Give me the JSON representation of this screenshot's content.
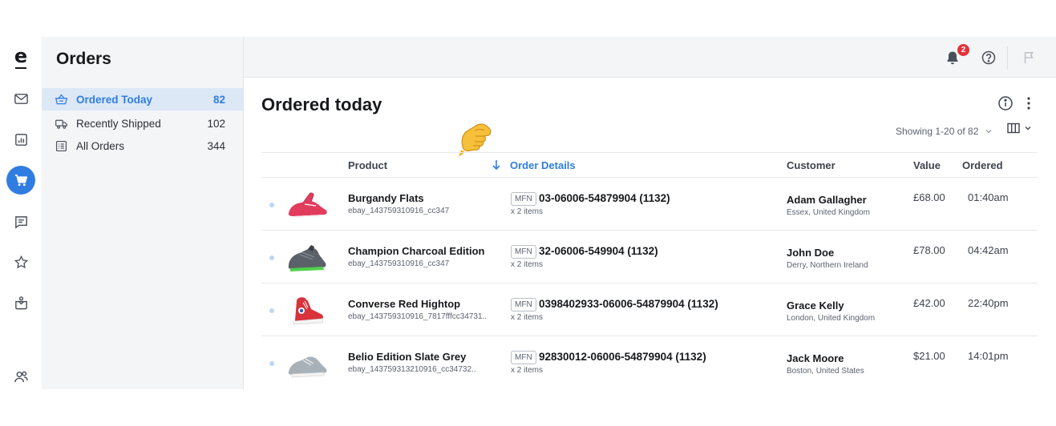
{
  "app": {
    "logo_letter": "e"
  },
  "rail": {
    "items": [
      {
        "icon": "mail-icon"
      },
      {
        "icon": "reports-icon"
      },
      {
        "icon": "cart-icon",
        "active": true
      },
      {
        "icon": "messages-icon"
      },
      {
        "icon": "star-icon"
      },
      {
        "icon": "box-icon"
      },
      {
        "icon": "users-icon"
      }
    ]
  },
  "sidebar": {
    "title": "Orders",
    "items": [
      {
        "label": "Ordered Today",
        "count": "82",
        "icon": "basket-icon",
        "active": true
      },
      {
        "label": "Recently Shipped",
        "count": "102",
        "icon": "truck-icon"
      },
      {
        "label": "All Orders",
        "count": "344",
        "icon": "list-icon"
      }
    ]
  },
  "topbar": {
    "notification_count": "2",
    "icons": [
      "bell-icon",
      "help-icon",
      "flag-icon"
    ]
  },
  "main": {
    "title": "Ordered today",
    "showing": "Showing 1-20 of 82",
    "columns": {
      "product": "Product",
      "order_details": "Order Details",
      "customer": "Customer",
      "value": "Value",
      "ordered": "Ordered"
    },
    "rows": [
      {
        "product": "Burgandy Flats",
        "sku": "ebay_143759310916_cc347",
        "tag": "MFN",
        "order_id": "03-06006-54879904 (1132)",
        "items": "x 2 items",
        "customer": "Adam Gallagher",
        "location": "Essex, United Kingdom",
        "value": "£68.00",
        "time": "01:40am",
        "shoe_color": "#e23c5d"
      },
      {
        "product": "Champion Charcoal Edition",
        "sku": "ebay_143759310916_cc347",
        "tag": "MFN",
        "order_id": "32-06006-549904 (1132)",
        "items": "x 2 items",
        "customer": "John Doe",
        "location": "Derry, Northern Ireland",
        "value": "£78.00",
        "time": "04:42am",
        "shoe_color": "#5b6168"
      },
      {
        "product": "Converse Red Hightop",
        "sku": "ebay_143759310916_7817fffcc34731..",
        "tag": "MFN",
        "order_id": "0398402933-06006-54879904 (1132)",
        "items": "x 2 items",
        "customer": "Grace Kelly",
        "location": "London, United Kingdom",
        "value": "£42.00",
        "time": "22:40pm",
        "shoe_color": "#d8323a"
      },
      {
        "product": "Belio Edition Slate Grey",
        "sku": "ebay_143759313210916_cc34732..",
        "tag": "MFN",
        "order_id": "92830012-06006-54879904 (1132)",
        "items": "x 2 items",
        "customer": "Jack Moore",
        "location": "Boston, United States",
        "value": "$21.00",
        "time": "14:01pm",
        "shoe_color": "#a9b1b8"
      }
    ]
  }
}
